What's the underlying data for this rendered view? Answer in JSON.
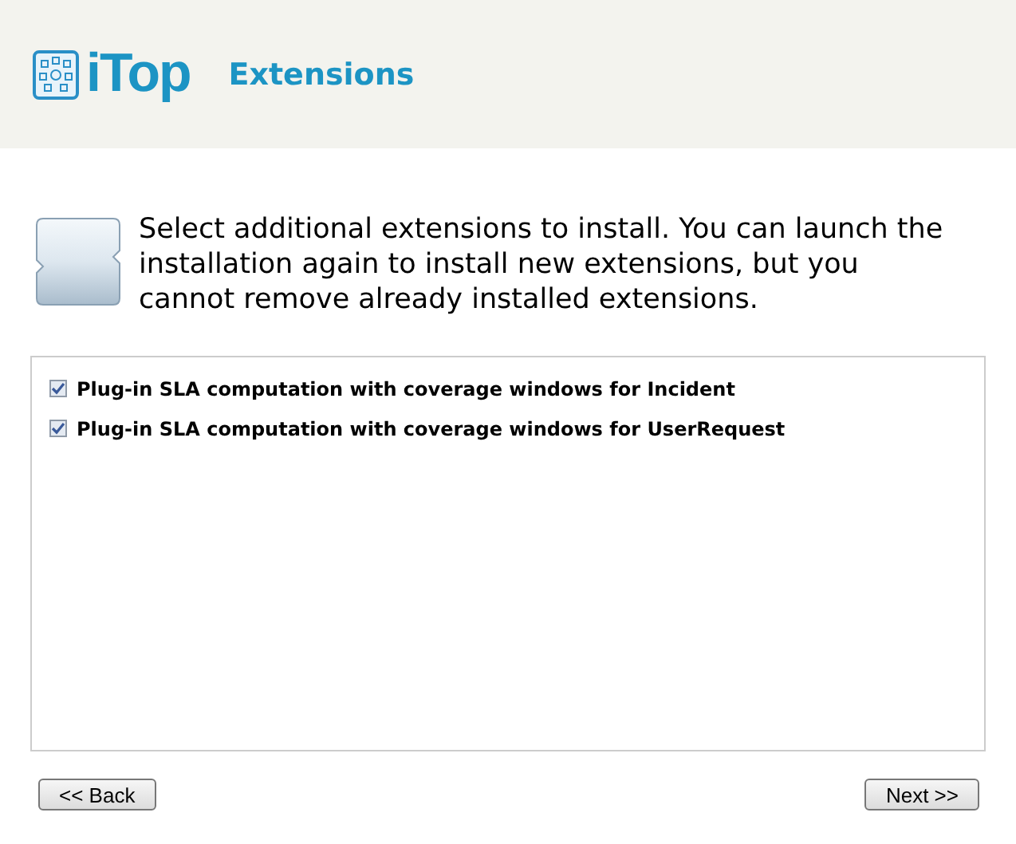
{
  "header": {
    "logo": "iTop",
    "title": "Extensions"
  },
  "intro": "Select additional extensions to install. You can launch the installation again to install new extensions, but you cannot remove already installed extensions.",
  "extensions": [
    {
      "label": "Plug-in SLA computation with coverage windows for Incident",
      "checked": true
    },
    {
      "label": "Plug-in SLA computation with coverage windows for UserRequest",
      "checked": true
    }
  ],
  "buttons": {
    "back": "<< Back",
    "next": "Next >>"
  }
}
